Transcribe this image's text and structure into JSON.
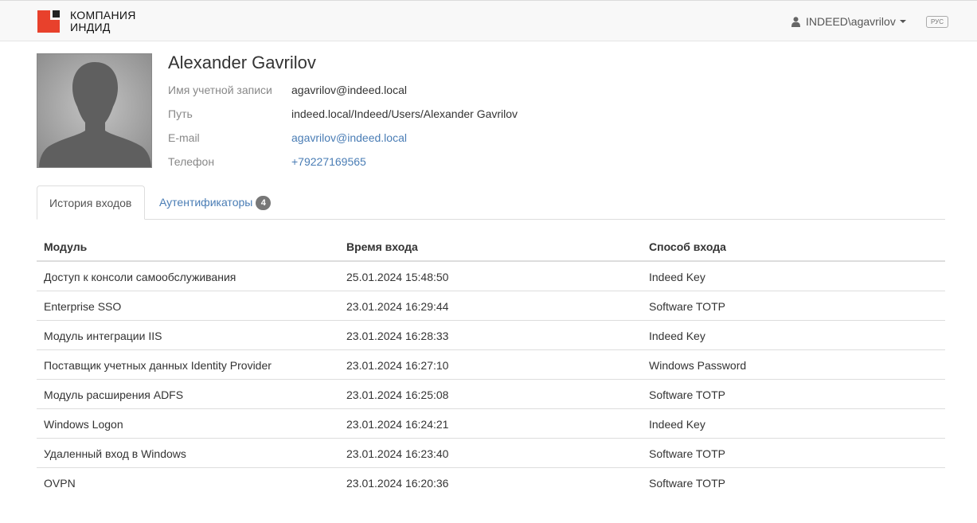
{
  "header": {
    "brand_line1": "КОМПАНИЯ",
    "brand_line2": "ИНДИД",
    "user": "INDEED\\agavrilov",
    "language": "РУС",
    "colors": {
      "brand_red": "#e8412c",
      "brand_dark": "#222222"
    }
  },
  "profile": {
    "name": "Alexander Gavrilov",
    "fields": [
      {
        "label": "Имя учетной записи",
        "value": "agavrilov@indeed.local"
      },
      {
        "label": "Путь",
        "value": "indeed.local/Indeed/Users/Alexander Gavrilov"
      },
      {
        "label": "E-mail",
        "value": "agavrilov@indeed.local"
      },
      {
        "label": "Телефон",
        "value": "+79227169565"
      }
    ]
  },
  "tabs": [
    {
      "label": "История входов",
      "active": true
    },
    {
      "label": "Аутентификаторы",
      "badge": "4",
      "active": false
    }
  ],
  "table": {
    "columns": [
      "Модуль",
      "Время входа",
      "Способ входа"
    ],
    "rows": [
      [
        "Доступ к консоли самообслуживания",
        "25.01.2024 15:48:50",
        "Indeed Key"
      ],
      [
        "Enterprise SSO",
        "23.01.2024 16:29:44",
        "Software TOTP"
      ],
      [
        "Модуль интеграции IIS",
        "23.01.2024 16:28:33",
        "Indeed Key"
      ],
      [
        "Поставщик учетных данных Identity Provider",
        "23.01.2024 16:27:10",
        "Windows Password"
      ],
      [
        "Модуль расширения ADFS",
        "23.01.2024 16:25:08",
        "Software TOTP"
      ],
      [
        "Windows Logon",
        "23.01.2024 16:24:21",
        "Indeed Key"
      ],
      [
        "Удаленный вход в Windows",
        "23.01.2024 16:23:40",
        "Software TOTP"
      ],
      [
        "OVPN",
        "23.01.2024 16:20:36",
        "Software TOTP"
      ]
    ]
  },
  "icons": {
    "user": "user-icon",
    "caret": "caret-down-icon",
    "logo": "company-logo"
  }
}
